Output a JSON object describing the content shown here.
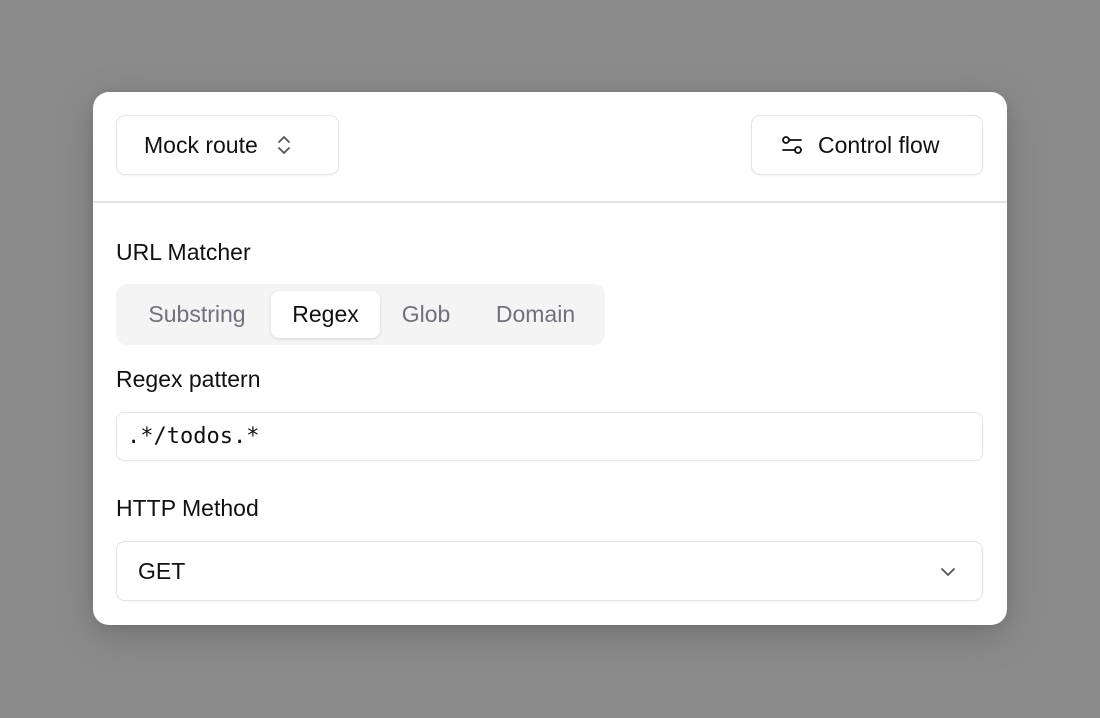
{
  "header": {
    "route_selector_label": "Mock route",
    "control_flow_label": "Control flow"
  },
  "url_matcher": {
    "label": "URL Matcher",
    "options": [
      "Substring",
      "Regex",
      "Glob",
      "Domain"
    ],
    "selected": "Regex"
  },
  "regex_pattern": {
    "label": "Regex pattern",
    "value": ".*/todos.*"
  },
  "http_method": {
    "label": "HTTP Method",
    "value": "GET"
  },
  "icons": {
    "route_selector": "chevron-up-down-icon",
    "control_flow": "sliders-icon",
    "method_select": "chevron-down-icon"
  }
}
